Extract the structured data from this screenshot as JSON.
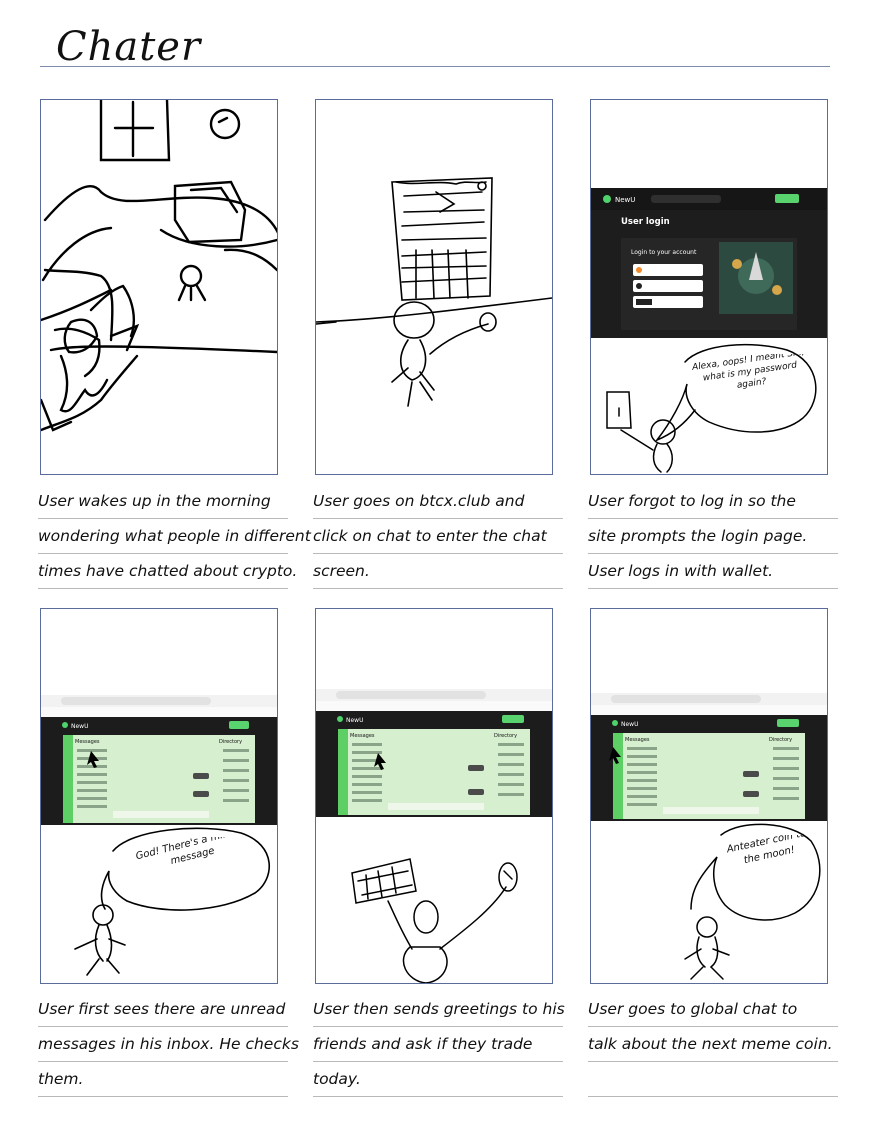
{
  "title": "Chater",
  "panels": [
    {
      "caption_lines": [
        "User wakes up in the morning",
        "wondering what people in different",
        "times have chatted about crypto."
      ],
      "speech": ""
    },
    {
      "caption_lines": [
        "User goes on btcx.club and",
        "click on chat to enter the chat",
        "screen."
      ],
      "speech": ""
    },
    {
      "caption_lines": [
        "User forgot to log in so the",
        "site prompts the login page.",
        "User logs in with wallet."
      ],
      "speech": "Alexa, oops! I meant Siri, what is my password again?",
      "screenshot": {
        "brand": "NewU",
        "page_title": "User login",
        "card_title": "Login to your account",
        "buttons": [
          "Sign in with Coinbase",
          "Sign in with Phantom",
          "Sign in with GN"
        ]
      }
    },
    {
      "caption_lines": [
        "User first sees there are unread",
        "messages in his inbox. He checks",
        "them."
      ],
      "speech": "God! There's a million message",
      "screenshot": {
        "brand": "NewU",
        "left_header": "Messages",
        "right_header": "Directory"
      }
    },
    {
      "caption_lines": [
        "User then sends greetings to his",
        "friends and ask if they trade",
        "today."
      ],
      "speech": "",
      "screenshot": {
        "brand": "NewU",
        "left_header": "Messages",
        "right_header": "Directory"
      }
    },
    {
      "caption_lines": [
        "User goes to global chat to",
        "talk about the next meme coin."
      ],
      "speech": "Anteater coin to the moon!",
      "screenshot": {
        "brand": "NewU",
        "left_header": "Messages",
        "right_header": "Directory"
      }
    }
  ]
}
